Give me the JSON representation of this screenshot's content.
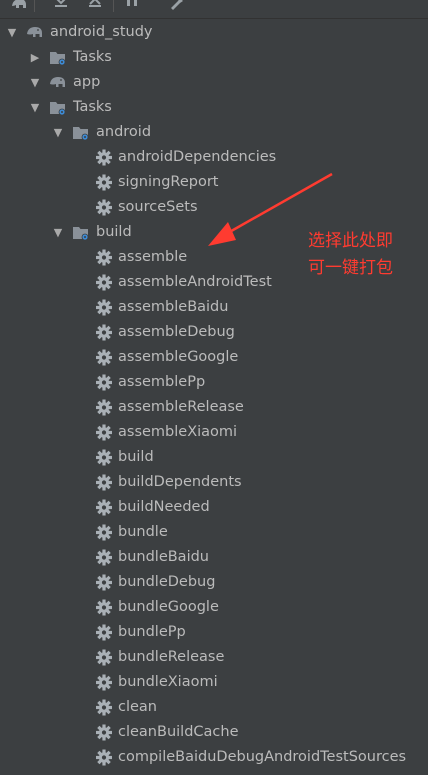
{
  "colors": {
    "background": "#3c3f41",
    "text": "#bbbbbb",
    "annotation": "#ff3b30",
    "folder": "#8a9199",
    "gear": "#a9b0b6"
  },
  "toolbar_icons": [
    "elephant-icon",
    "expand-all-icon",
    "collapse-all-icon",
    "execute-task-icon",
    "wrench-icon"
  ],
  "tree": {
    "root": "android_study",
    "root_tasks": "Tasks",
    "app": "app",
    "app_tasks": "Tasks",
    "android_group": "android",
    "android_items": [
      "androidDependencies",
      "signingReport",
      "sourceSets"
    ],
    "build_group": "build",
    "build_items": [
      "assemble",
      "assembleAndroidTest",
      "assembleBaidu",
      "assembleDebug",
      "assembleGoogle",
      "assemblePp",
      "assembleRelease",
      "assembleXiaomi",
      "build",
      "buildDependents",
      "buildNeeded",
      "bundle",
      "bundleBaidu",
      "bundleDebug",
      "bundleGoogle",
      "bundlePp",
      "bundleRelease",
      "bundleXiaomi",
      "clean",
      "cleanBuildCache",
      "compileBaiduDebugAndroidTestSources"
    ]
  },
  "annotation": {
    "line1": "选择此处即",
    "line2": "可一键打包"
  }
}
